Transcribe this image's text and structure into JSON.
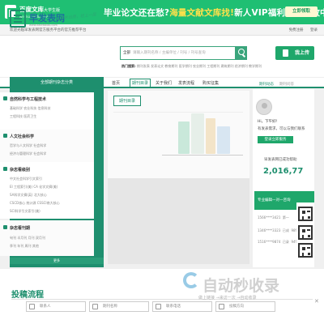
{
  "banner": {
    "brand": "百度文库",
    "brand_sub": "大学生版",
    "url": "wenku.baidu.com",
    "headline_part1": "毕业论文还在愁?",
    "headline_part2": "海量文献文库找!",
    "headline_part3": "新人VIP福利限时发放中",
    "cta": "立即领取"
  },
  "topbar": {
    "welcome": "欢迎光临早发表网官方服务平台的官方推荐平台",
    "links": [
      "免费注册",
      "登录"
    ]
  },
  "header": {
    "site_name": "早发表网",
    "slogan": "让学术出版，轻上一层",
    "site_url": "www.zaofabiao.com",
    "search_type": "全部",
    "search_placeholder": "请输入期刊名称 / 主编单位 / 刊号 / 刊号查询",
    "hotwords_label": "热门搜索:",
    "hotwords": "期刊发表 发表论文 教育期刊 医学期刊 农业期刊 工程期刊 建筑期刊 经济期刊 教学期刊",
    "submit_label": "我上传"
  },
  "nav": {
    "category_label": "全部期刊杂志分类",
    "items": [
      "首页",
      "期刊目录",
      "关于我们",
      "发表流程",
      "购买征集"
    ],
    "active_index": 1,
    "right_tabs": [
      "期刊动态",
      "期刊问答"
    ]
  },
  "sidebar": {
    "sections": [
      {
        "title": "自然科学与工程技术",
        "lines": [
          "基础科学 农业科技 信息科技",
          "工程科技 医药卫生"
        ]
      },
      {
        "title": "人文社会科学",
        "lines": [
          "哲学与人文科学 社会科学",
          "经济与管理科学 社会科学"
        ]
      },
      {
        "title": "杂志看级别",
        "lines": [
          "中文社会科学引文索引",
          "EI 工程索引(美) CA 化学文摘(美)",
          "SA科学文摘(英) 北大核心",
          "CSCD核心 统计源 CSSCI南大核心",
          "SCI科学引文索引(美)"
        ]
      },
      {
        "title": "杂志看刊期",
        "lines": [
          "旬刊 半月刊 月刊 双月刊",
          "季刊 年刊 周刊 其他"
        ]
      }
    ],
    "footer": "更多"
  },
  "main": {
    "tab_label": "期刊目录"
  },
  "right_panel": {
    "greeting": "Hi，下午好!",
    "desc": "有发表需求，可以与我们联系",
    "login_btn": "登录立即服务",
    "count_label": "早发表网已成功帮助",
    "count_value": "2,016,77",
    "consult_label": "专业编辑一对一咨询",
    "rows": [
      {
        "phone": "1566****3421",
        "status": "第一",
        "pct": ""
      },
      {
        "phone": "1346****3323",
        "status": "已成",
        "pct": "98%"
      },
      {
        "phone": "1516****9874",
        "status": "已录",
        "pct": "94%"
      }
    ]
  },
  "bottom": {
    "flow_title": "投稿流程",
    "fields": [
      "联系人",
      "期刊名称",
      "联系电话",
      "投稿方向"
    ]
  },
  "watermark": {
    "text": "自动秒收录",
    "sub": "做上链接 →来访一次 →自动收录"
  }
}
